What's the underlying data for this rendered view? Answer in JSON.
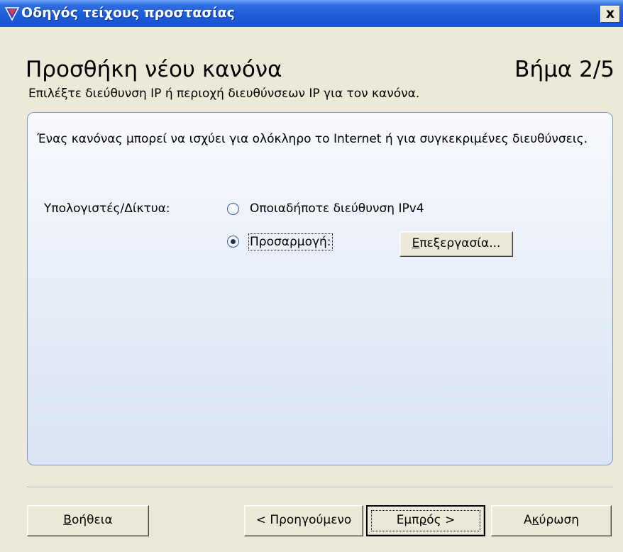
{
  "window": {
    "title": "Οδηγός τείχους προστασίας",
    "close_glyph": "x",
    "icon": "firewall-wizard-icon"
  },
  "header": {
    "title": "Προσθήκη νέου κανόνα",
    "step": "Βήμα 2/5",
    "subtitle": "Επιλέξτε διεύθυνση IP ή περιοχή διευθύνσεων IP για τον κανόνα."
  },
  "panel": {
    "description": "Ένας κανόνας μπορεί να ισχύει για ολόκληρο το Internet ή για συγκεκριμένες διευθύνσεις.",
    "computers_label": "Υπολογιστές/Δίκτυα:",
    "options": [
      {
        "label": "Οποιαδήποτε διεύθυνση IPv4",
        "selected": false
      },
      {
        "label": "Προσαρμογή:",
        "selected": true
      }
    ],
    "edit_button": {
      "accel": "Ε",
      "rest": "πεξεργασία..."
    }
  },
  "footer": {
    "help": {
      "accel": "Β",
      "rest": "οήθεια"
    },
    "back": {
      "label": "< Προηγούμενο"
    },
    "next": {
      "before": "Εμπ",
      "accel": "ρ",
      "after": "ός >"
    },
    "cancel": {
      "before": "Α",
      "accel": "κ",
      "after": "ύρωση"
    }
  },
  "colors": {
    "titlebar": "#1d5ad6",
    "dialog_bg": "#ece9d8",
    "panel_border": "#7f9db9"
  }
}
